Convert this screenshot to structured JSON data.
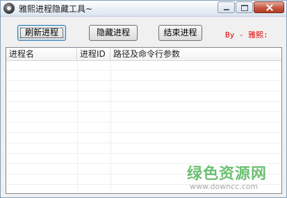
{
  "window": {
    "title": "雅熙进程隐藏工具~"
  },
  "toolbar": {
    "refresh_label": "刷新进程",
    "hide_label": "隐藏进程",
    "end_label": "结束进程",
    "author": "By - 雅熙:"
  },
  "list": {
    "columns": [
      "进程名",
      "进程ID",
      "路径及命令行参数"
    ],
    "rows": []
  },
  "watermark": {
    "text": "绿色资源网",
    "url": "www.downcc.com"
  },
  "colors": {
    "author": "#e00000",
    "watermark": "#52b65a"
  }
}
